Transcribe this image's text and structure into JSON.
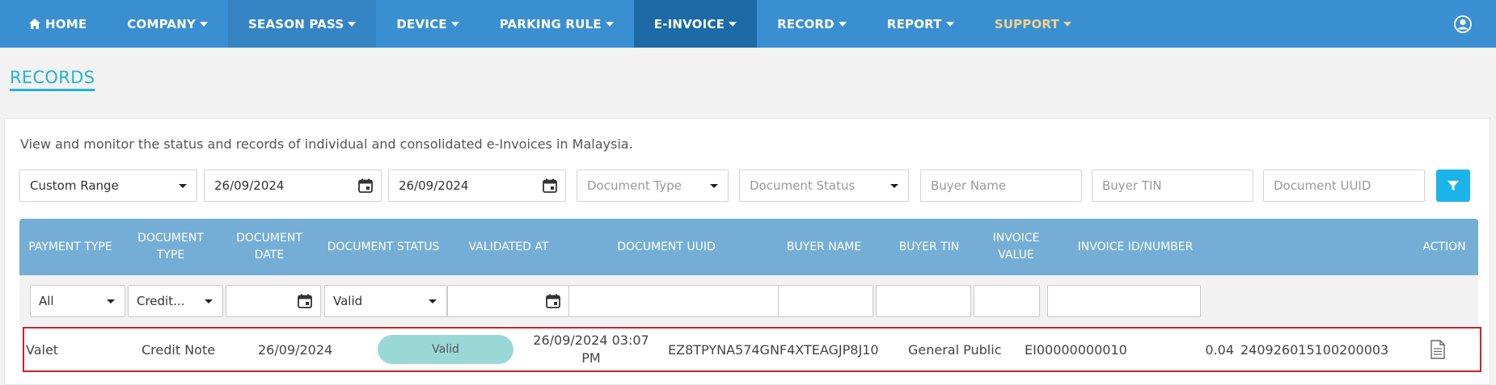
{
  "nav": {
    "items": [
      {
        "label": "HOME"
      },
      {
        "label": "COMPANY"
      },
      {
        "label": "SEASON PASS"
      },
      {
        "label": "DEVICE"
      },
      {
        "label": "PARKING RULE"
      },
      {
        "label": "E-INVOICE"
      },
      {
        "label": "RECORD"
      },
      {
        "label": "REPORT"
      },
      {
        "label": "SUPPORT"
      }
    ],
    "active": "E-INVOICE",
    "colors": {
      "bar": "#3a8fd0",
      "active": "#1c6aa6",
      "support": "#f1d28c"
    }
  },
  "page": {
    "title": "RECORDS",
    "description": "View and monitor the status and records of individual and consolidated e-Invoices in Malaysia."
  },
  "filters": {
    "range": "Custom Range",
    "date_from": "26/09/2024",
    "date_to": "26/09/2024",
    "document_type_placeholder": "Document Type",
    "document_status_placeholder": "Document Status",
    "buyer_name_placeholder": "Buyer Name",
    "buyer_tin_placeholder": "Buyer TIN",
    "document_uuid_placeholder": "Document UUID"
  },
  "table": {
    "headers": {
      "payment_type": "PAYMENT TYPE",
      "document_type_1": "DOCUMENT",
      "document_type_2": "TYPE",
      "document_date_1": "DOCUMENT",
      "document_date_2": "DATE",
      "document_status": "DOCUMENT STATUS",
      "validated_at": "VALIDATED AT",
      "document_uuid": "DOCUMENT UUID",
      "buyer_name": "BUYER NAME",
      "buyer_tin": "BUYER TIN",
      "invoice_value_1": "INVOICE",
      "invoice_value_2": "VALUE",
      "invoice_id": "INVOICE ID/NUMBER",
      "action": "ACTION"
    },
    "column_filters": {
      "payment_type": "All",
      "document_type": "Credit...",
      "document_status": "Valid"
    },
    "rows": [
      {
        "payment_type": "Valet",
        "document_type": "Credit Note",
        "document_date": "26/09/2024",
        "document_status": "Valid",
        "validated_at_1": "26/09/2024 03:07",
        "validated_at_2": "PM",
        "document_uuid": "EZ8TPYNA574GNF4XTEAGJP8J10",
        "buyer_name": "General Public",
        "buyer_tin": "EI00000000010",
        "invoice_value": "0.04",
        "invoice_id": "240926015100200003",
        "action_icon": "document-icon"
      }
    ],
    "colors": {
      "header": "#74aed6",
      "badge": "#9ad8d8",
      "highlight": "#d32027"
    }
  }
}
